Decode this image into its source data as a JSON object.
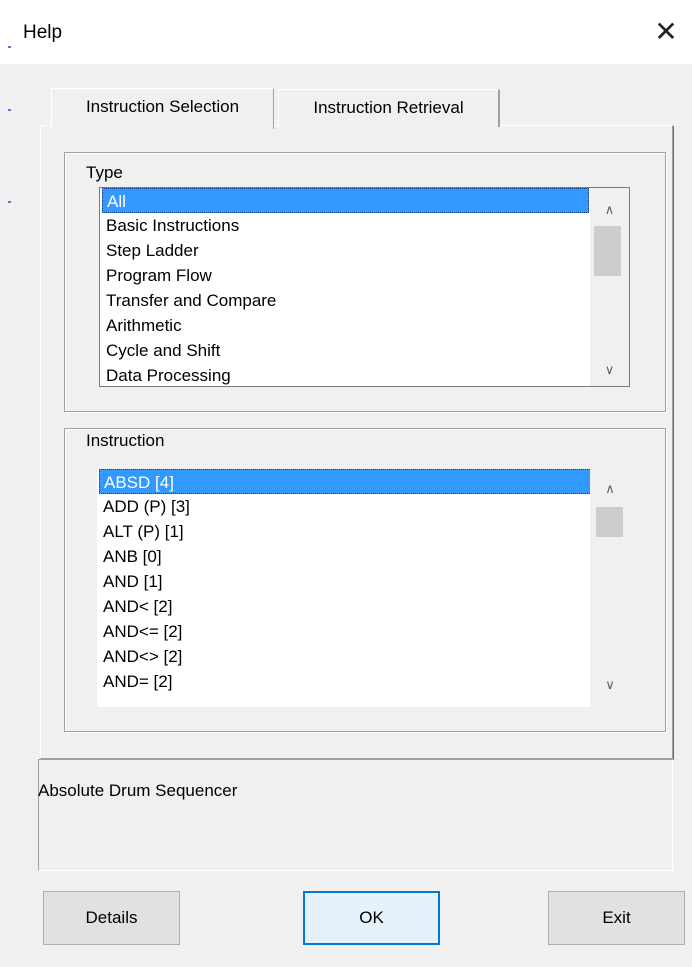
{
  "window": {
    "title": "Help",
    "close_glyph": "✕"
  },
  "tabs": [
    {
      "label": "Instruction Selection",
      "active": true
    },
    {
      "label": "Instruction Retrieval",
      "active": false
    }
  ],
  "type_group": {
    "label": "Type",
    "items": [
      "All",
      "Basic Instructions",
      "Step Ladder",
      "Program Flow",
      "Transfer and Compare",
      "Arithmetic",
      "Cycle and Shift",
      "Data Processing"
    ],
    "selected": "All"
  },
  "instruction_group": {
    "label": "Instruction",
    "items": [
      "ABSD [4]",
      "ADD (P)  [3]",
      "ALT (P)  [1]",
      "ANB [0]",
      "AND [1]",
      "AND< [2]",
      "AND<= [2]",
      "AND<> [2]",
      "AND= [2]"
    ],
    "selected": "ABSD [4]"
  },
  "description": "Absolute Drum Sequencer",
  "buttons": {
    "details": "Details",
    "ok": "OK",
    "exit": "Exit"
  },
  "icons": {
    "scroll_up": "chevron-up-icon",
    "scroll_down": "chevron-down-icon",
    "close": "close-icon"
  },
  "colors": {
    "selection": "#3399ff",
    "default_button_border": "#0078d7",
    "dialog_bg": "#f0f0f0"
  }
}
